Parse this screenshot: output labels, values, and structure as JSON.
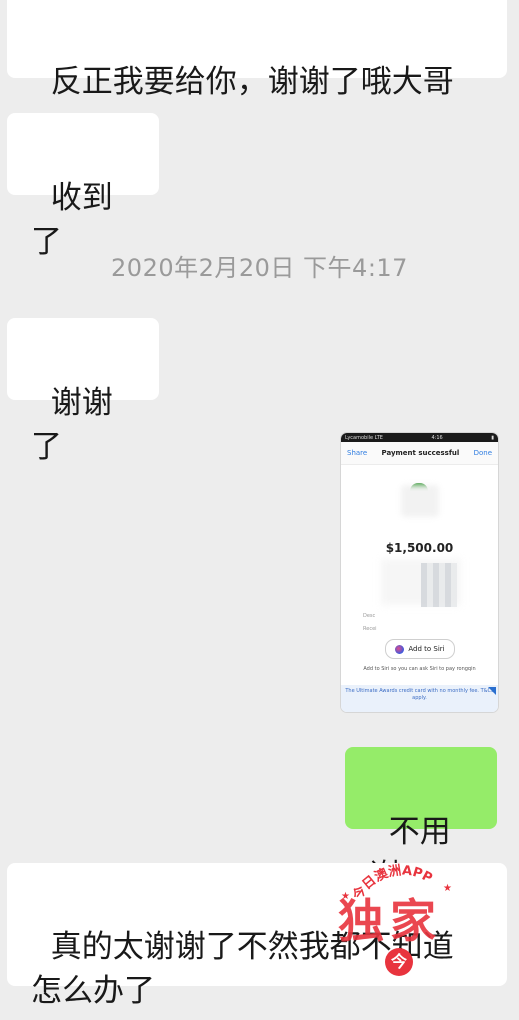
{
  "messages": {
    "m1": "反正我要给你，谢谢了哦大哥",
    "m2": "收到了",
    "timestamp": "2020年2月20日 下午4:17",
    "m3": "谢谢了",
    "m4": "不用谢",
    "m5": "真的太谢谢了不然我都不知道\n怎么办了"
  },
  "screenshot": {
    "status_left": "Lycamobile LTE",
    "status_time": "4:16",
    "share": "Share",
    "title": "Payment successful",
    "done": "Done",
    "amount": "$1,500.00",
    "label_desc": "Desc",
    "label_recv": "Recei",
    "siri_button": "Add to Siri",
    "siri_note": "Add to Siri so you can ask Siri to pay rongqin",
    "promo": "The Ultimate Awards credit card with no monthly fee. T&Cs apply."
  },
  "watermark": {
    "app_name": "今日澳洲APP",
    "stamp": "独家",
    "badge": "今"
  }
}
